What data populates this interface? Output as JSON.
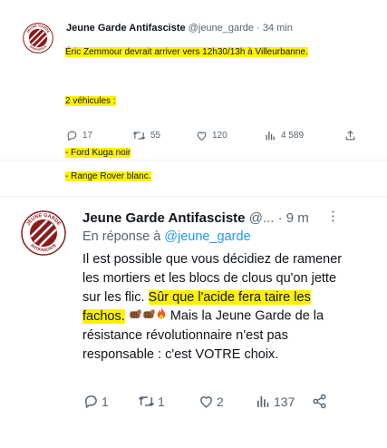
{
  "tweet1": {
    "author_name": "Jeune Garde Antifasciste",
    "handle": "@jeune_garde",
    "separator": " · ",
    "time": "34 min",
    "lines": [
      "Éric Zemmour devrait arriver vers 12h30/13h à Villeurbanne.",
      "",
      "2 véhicules :",
      "",
      "- Ford Kuga noir",
      "- Range Rover blanc."
    ],
    "counts": {
      "replies": "17",
      "retweets": "55",
      "likes": "120",
      "views": "4 589"
    }
  },
  "tweet2": {
    "author_name": "Jeune Garde Antifasciste",
    "handle": "@...",
    "separator": " · ",
    "time": "9 m",
    "more_label": "⋮",
    "reply_prefix": "En réponse à",
    "reply_to": "@jeune_garde",
    "body_plain": "Il est possible que vous décidiez de ramener les mortiers et les blocs de clous qu'on jette sur les flic.",
    "body_highlight": "Sûr que l'acide fera taire les fachos.",
    "body_rest": "Mais la Jeune Garde de la résistance révolutionnaire n'est pas responsable : c'est VOTRE choix.",
    "counts": {
      "replies": "1",
      "retweets": "1",
      "likes": "2",
      "views": "137"
    }
  },
  "avatar_text": [
    "JEUNE GARDE",
    "ANTIFASCISTE"
  ],
  "colors": {
    "highlight": "#fff200",
    "avatar_red": "#8b1a1a",
    "secondary_text": "#536471",
    "link": "#1d9bf0",
    "text": "#0f1419"
  },
  "icons": [
    "reply-icon",
    "retweet-icon",
    "like-icon",
    "views-icon",
    "share-icon",
    "share-network-icon",
    "more-icon",
    "fist-emoji",
    "fire-emoji"
  ]
}
